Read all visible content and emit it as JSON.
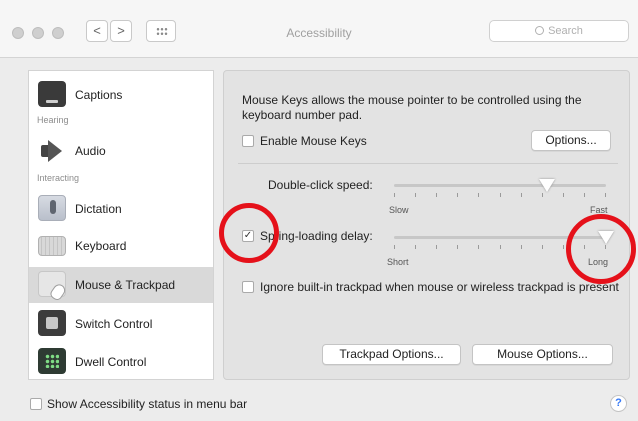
{
  "window": {
    "title": "Accessibility",
    "search_placeholder": "Search",
    "nav_back": "<",
    "nav_forward": ">"
  },
  "sidebar": {
    "sections": [
      "Hearing",
      "Interacting"
    ],
    "items": [
      {
        "label": "Captions",
        "icon": "captions-icon"
      },
      {
        "label": "Audio",
        "icon": "speaker-icon"
      },
      {
        "label": "Dictation",
        "icon": "microphone-icon"
      },
      {
        "label": "Keyboard",
        "icon": "keyboard-icon"
      },
      {
        "label": "Mouse & Trackpad",
        "icon": "mouse-trackpad-icon",
        "selected": true
      },
      {
        "label": "Switch Control",
        "icon": "switch-control-icon"
      },
      {
        "label": "Dwell Control",
        "icon": "dwell-control-icon"
      }
    ]
  },
  "main": {
    "description": "Mouse Keys allows the mouse pointer to be controlled using the keyboard number pad.",
    "enable_mouse_keys": {
      "label": "Enable Mouse Keys",
      "checked": false
    },
    "options_button": "Options...",
    "double_click": {
      "label": "Double-click speed:",
      "min_label": "Slow",
      "max_label": "Fast",
      "value": 0.72
    },
    "spring_loading": {
      "label": "Spring-loading delay:",
      "checked": true,
      "checkmark": "✓",
      "min_label": "Short",
      "max_label": "Long",
      "value": 1.0
    },
    "ignore_trackpad": {
      "label": "Ignore built-in trackpad when mouse or wireless trackpad is present",
      "checked": false
    },
    "trackpad_options_button": "Trackpad Options...",
    "mouse_options_button": "Mouse Options..."
  },
  "footer": {
    "show_status_label": "Show Accessibility status in menu bar",
    "show_status_checked": false,
    "help_label": "?"
  },
  "annotation_color": "#e5111a"
}
